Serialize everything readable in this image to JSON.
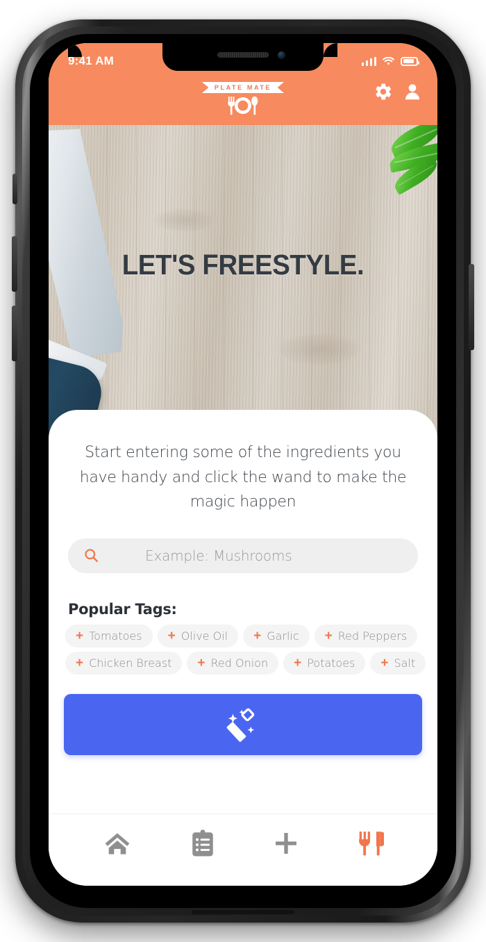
{
  "status_bar": {
    "time": "9:41 AM",
    "signal_icon": "signal-bars-icon",
    "wifi_icon": "wifi-icon",
    "battery_icon": "battery-icon"
  },
  "header": {
    "brand": "PLATE MATE",
    "logo_icon": "fork-plate-spoon-icon",
    "background_color": "#F78A5E",
    "actions": [
      {
        "name": "settings",
        "icon": "gear-icon"
      },
      {
        "name": "profile",
        "icon": "person-icon"
      }
    ]
  },
  "hero": {
    "title": "LET'S FREESTYLE.",
    "title_color": "#343b42",
    "background": "wood-cutting-board-photo",
    "props": [
      "chef-knife",
      "basil-leaves"
    ]
  },
  "card": {
    "intro_text": "Start entering some of the ingredients you have handy and click the wand to make the magic happen",
    "search": {
      "icon": "search-icon",
      "icon_color": "#F2764B",
      "placeholder": "Example: Mushrooms",
      "value": ""
    },
    "tags": {
      "title": "Popular Tags:",
      "add_glyph": "+",
      "rows": [
        [
          {
            "label": "Tomatoes"
          },
          {
            "label": "Olive Oil"
          },
          {
            "label": "Garlic"
          },
          {
            "label": "Red Peppers"
          }
        ],
        [
          {
            "label": "Chicken Breast"
          },
          {
            "label": "Red Onion"
          },
          {
            "label": "Potatoes"
          },
          {
            "label": "Salt"
          }
        ]
      ]
    },
    "primary_button": {
      "icon": "magic-wand-icon",
      "label": "",
      "color": "#4a66f0"
    }
  },
  "bottom_nav": {
    "items": [
      {
        "name": "home",
        "icon": "home-icon",
        "active": false,
        "color": "#8f8f8f"
      },
      {
        "name": "list",
        "icon": "clipboard-list-icon",
        "active": false,
        "color": "#8f8f8f"
      },
      {
        "name": "add",
        "icon": "plus-icon",
        "active": false,
        "color": "#8f8f8f"
      },
      {
        "name": "meals",
        "icon": "fork-knife-icon",
        "active": true,
        "color": "#F2764B"
      }
    ]
  }
}
